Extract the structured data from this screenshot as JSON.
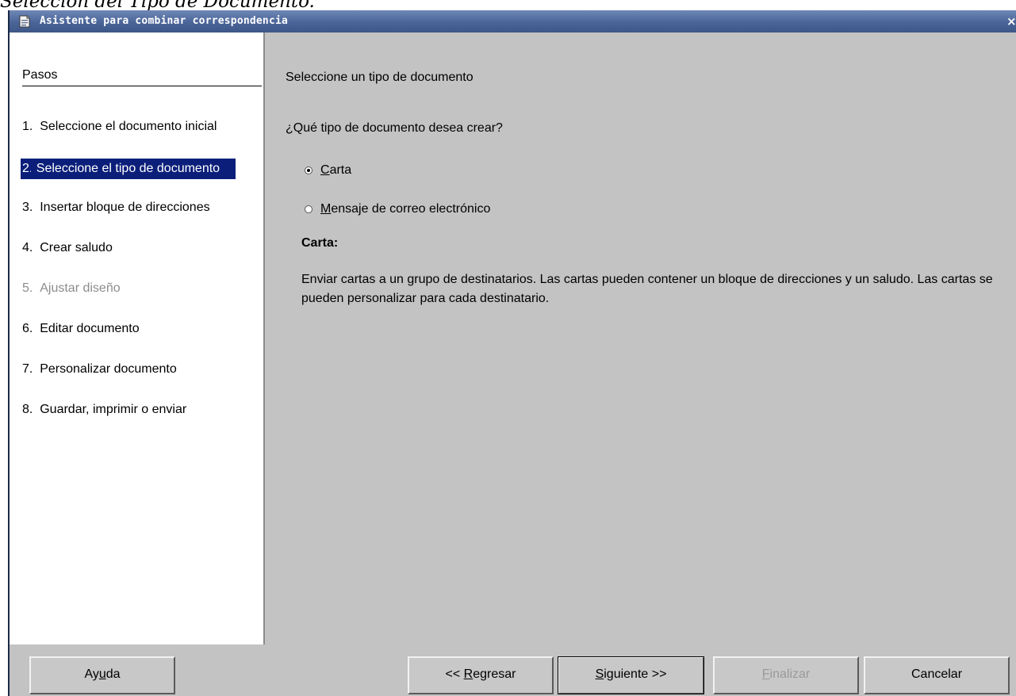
{
  "caption": "Selección del Tipo de Documento.",
  "window": {
    "title": "Asistente para combinar correspondencia",
    "close_label": "×"
  },
  "sidebar": {
    "heading": "Pasos",
    "steps": [
      {
        "num": "1.",
        "label": "Seleccione el documento inicial",
        "state": "normal"
      },
      {
        "num": "2.",
        "label": "Seleccione el tipo de documento",
        "state": "active"
      },
      {
        "num": "3.",
        "label": "Insertar bloque de direcciones",
        "state": "normal"
      },
      {
        "num": "4.",
        "label": "Crear saludo",
        "state": "normal"
      },
      {
        "num": "5.",
        "label": "Ajustar diseño",
        "state": "disabled"
      },
      {
        "num": "6.",
        "label": "Editar documento",
        "state": "normal"
      },
      {
        "num": "7.",
        "label": "Personalizar documento",
        "state": "normal"
      },
      {
        "num": "8.",
        "label": "Guardar, imprimir o enviar",
        "state": "normal"
      }
    ]
  },
  "content": {
    "title": "Seleccione un tipo de documento",
    "question": "¿Qué tipo de documento desea crear?",
    "options": [
      {
        "mnemonic": "C",
        "rest": "arta",
        "checked": true
      },
      {
        "mnemonic": "M",
        "rest": "ensaje de correo electrónico",
        "checked": false
      }
    ],
    "description_title": "Carta:",
    "description_text": "Enviar cartas a un grupo de destinatarios. Las cartas pueden contener un bloque de direcciones y un saludo. Las cartas se pueden personalizar para cada destinatario."
  },
  "buttons": {
    "help": {
      "pre": "Ay",
      "mnemonic": "u",
      "post": "da"
    },
    "back": {
      "pre": "<< ",
      "mnemonic": "R",
      "post": "egresar"
    },
    "next": {
      "pre": "",
      "mnemonic": "S",
      "post": "iguiente >>"
    },
    "finish": {
      "pre": "",
      "mnemonic": "F",
      "post": "inalizar"
    },
    "cancel": {
      "pre": "Cancelar",
      "mnemonic": "",
      "post": ""
    }
  },
  "colors": {
    "selection": "#0b1f7a",
    "titlebar": "#4a6498",
    "panel": "#c3c3c3"
  }
}
